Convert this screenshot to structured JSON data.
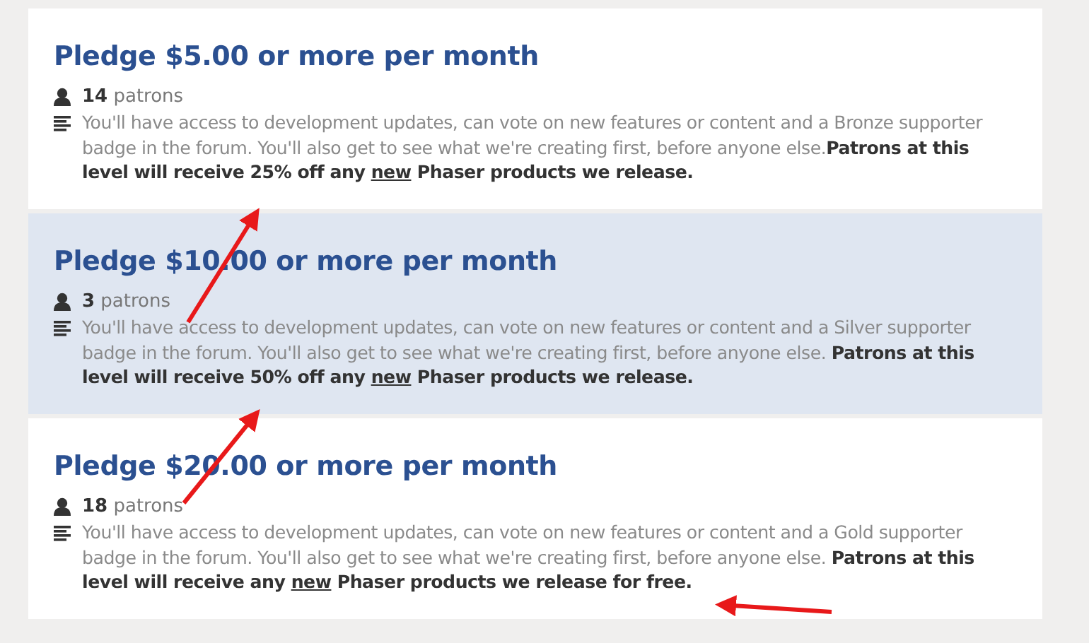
{
  "tiers": [
    {
      "title": "Pledge $5.00 or more per month",
      "patron_count": "14",
      "patron_label": "patrons",
      "selected": false,
      "description": [
        {
          "kind": "plain",
          "text": "You'll have access to development updates, can vote on new features or content and a Bronze supporter badge in the forum. You'll also get to see what we're creating first, before anyone else."
        },
        {
          "kind": "bold",
          "text": "Patrons at this level will receive 25% off any "
        },
        {
          "kind": "underline",
          "text": "new"
        },
        {
          "kind": "bold",
          "text": " Phaser products we release."
        }
      ]
    },
    {
      "title": "Pledge $10.00 or more per month",
      "patron_count": "3",
      "patron_label": "patrons",
      "selected": true,
      "description": [
        {
          "kind": "plain",
          "text": "You'll have access to development updates, can vote on new features or content and a Silver supporter badge in the forum. You'll also get to see what we're creating first, before anyone else. "
        },
        {
          "kind": "bold",
          "text": "Patrons at this level will receive 50% off any "
        },
        {
          "kind": "underline",
          "text": "new"
        },
        {
          "kind": "bold",
          "text": " Phaser products we release."
        }
      ]
    },
    {
      "title": "Pledge $20.00 or more per month",
      "patron_count": "18",
      "patron_label": "patrons",
      "selected": false,
      "description": [
        {
          "kind": "plain",
          "text": "You'll have access to development updates, can vote on new features or content and a Gold supporter badge in the forum. You'll also get to see what we're creating first, before anyone else. "
        },
        {
          "kind": "bold",
          "text": "Patrons at this level will receive any "
        },
        {
          "kind": "underline",
          "text": "new"
        },
        {
          "kind": "bold",
          "text": " Phaser products we release for free."
        }
      ]
    }
  ]
}
